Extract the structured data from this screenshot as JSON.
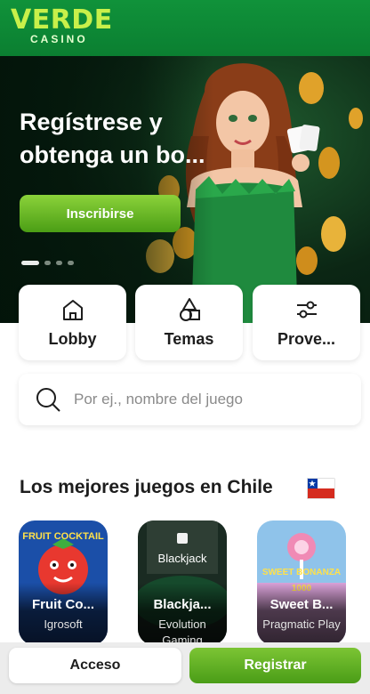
{
  "header": {
    "logo_main": "VERDE",
    "logo_sub": "CASINO",
    "brand_color": "#0b7f31",
    "logo_color": "#c8f04a"
  },
  "hero": {
    "title": "Regístrese y obtenga un bo...",
    "cta_label": "Inscribirse",
    "slides_total": 4,
    "active_slide": 1
  },
  "categories": [
    {
      "label": "Lobby",
      "icon": "home-icon"
    },
    {
      "label": "Temas",
      "icon": "shapes-icon"
    },
    {
      "label": "Prove...",
      "icon": "sliders-icon"
    }
  ],
  "search": {
    "placeholder": "Por ej., nombre del juego",
    "icon": "search-icon"
  },
  "section": {
    "title": "Los mejores juegos en Chile",
    "flag": "chile-flag-icon"
  },
  "games": [
    {
      "name": "Fruit Co...",
      "provider": "Igrosoft",
      "badge": "FRUIT COCKTAIL"
    },
    {
      "name": "Blackja...",
      "provider": "Evolution Gaming",
      "badge": "Blackjack"
    },
    {
      "name": "Sweet B...",
      "provider": "Pragmatic Play",
      "badge": "SWEET BONANZA 1000"
    }
  ],
  "footer": {
    "login_label": "Acceso",
    "register_label": "Registrar",
    "accent_color": "#4a9d17"
  }
}
